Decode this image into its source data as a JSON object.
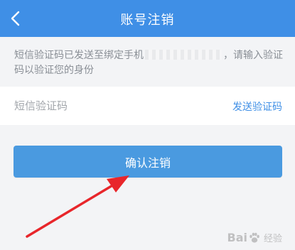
{
  "header": {
    "title": "账号注销",
    "back_icon": "chevron-left-icon"
  },
  "notice": {
    "text_before": "短信验证码已发送至绑定手机",
    "text_after": "，请输入验证码以验证您的身份"
  },
  "code_field": {
    "placeholder": "短信验证码",
    "value": "",
    "send_label": "发送验证码"
  },
  "confirm_button": {
    "label": "确认注销"
  },
  "watermark": {
    "brand_left": "Bai",
    "brand_right": "经验",
    "icon": "paw-icon"
  },
  "colors": {
    "header": "#3f8fe6",
    "primary_button": "#4a9ae0",
    "link": "#3f8fe6",
    "background": "#f3f4f6",
    "arrow": "#e8262b"
  }
}
